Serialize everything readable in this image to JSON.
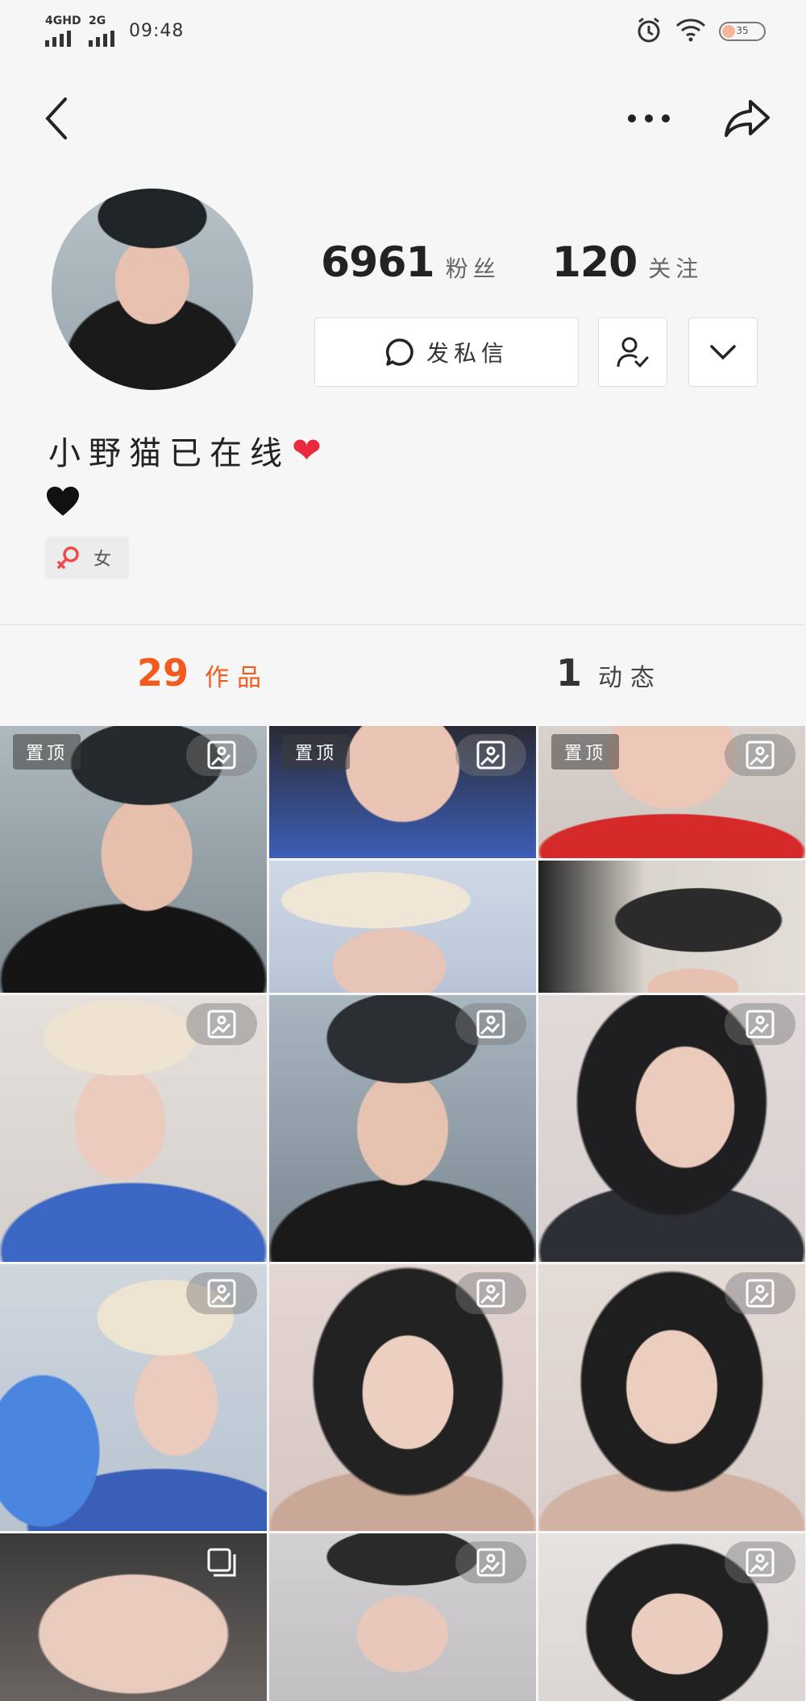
{
  "status_bar": {
    "sig1_label": "4GHD",
    "sig2_label": "2G",
    "time": "09:48",
    "battery": "35"
  },
  "icons": {
    "back": "back-chevron-icon",
    "more": "more-dots-icon",
    "share": "share-icon",
    "message": "chat-bubble-icon",
    "follow": "user-check-icon",
    "dropdown": "chevron-down-icon",
    "gender": "female-symbol-icon",
    "photo": "photo-icon",
    "multi": "multi-image-icon"
  },
  "profile": {
    "followers_count": "6961",
    "followers_label": "粉丝",
    "following_count": "120",
    "following_label": "关注",
    "message_button": "发私信",
    "bio_line": "小野猫已在线",
    "bio_emoji": "❤",
    "bio_line2_emoji": "🖤",
    "gender": "女"
  },
  "tabs": {
    "works_count": "29",
    "works_label": "作品",
    "moments_count": "1",
    "moments_label": "动态"
  },
  "grid": {
    "pinned_label": "置顶"
  },
  "colors": {
    "accent": "#f25b1d",
    "background": "#f6f6f6"
  }
}
